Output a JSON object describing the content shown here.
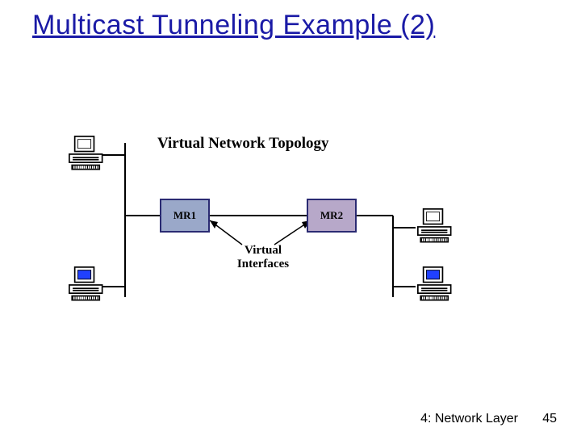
{
  "title": "Multicast Tunneling Example (2)",
  "section_label": "Virtual Network Topology",
  "routers": {
    "mr1": "MR1",
    "mr2": "MR2"
  },
  "virtual_interfaces_label": "Virtual\nInterfaces",
  "footer": "4: Network Layer",
  "page_number": "45"
}
